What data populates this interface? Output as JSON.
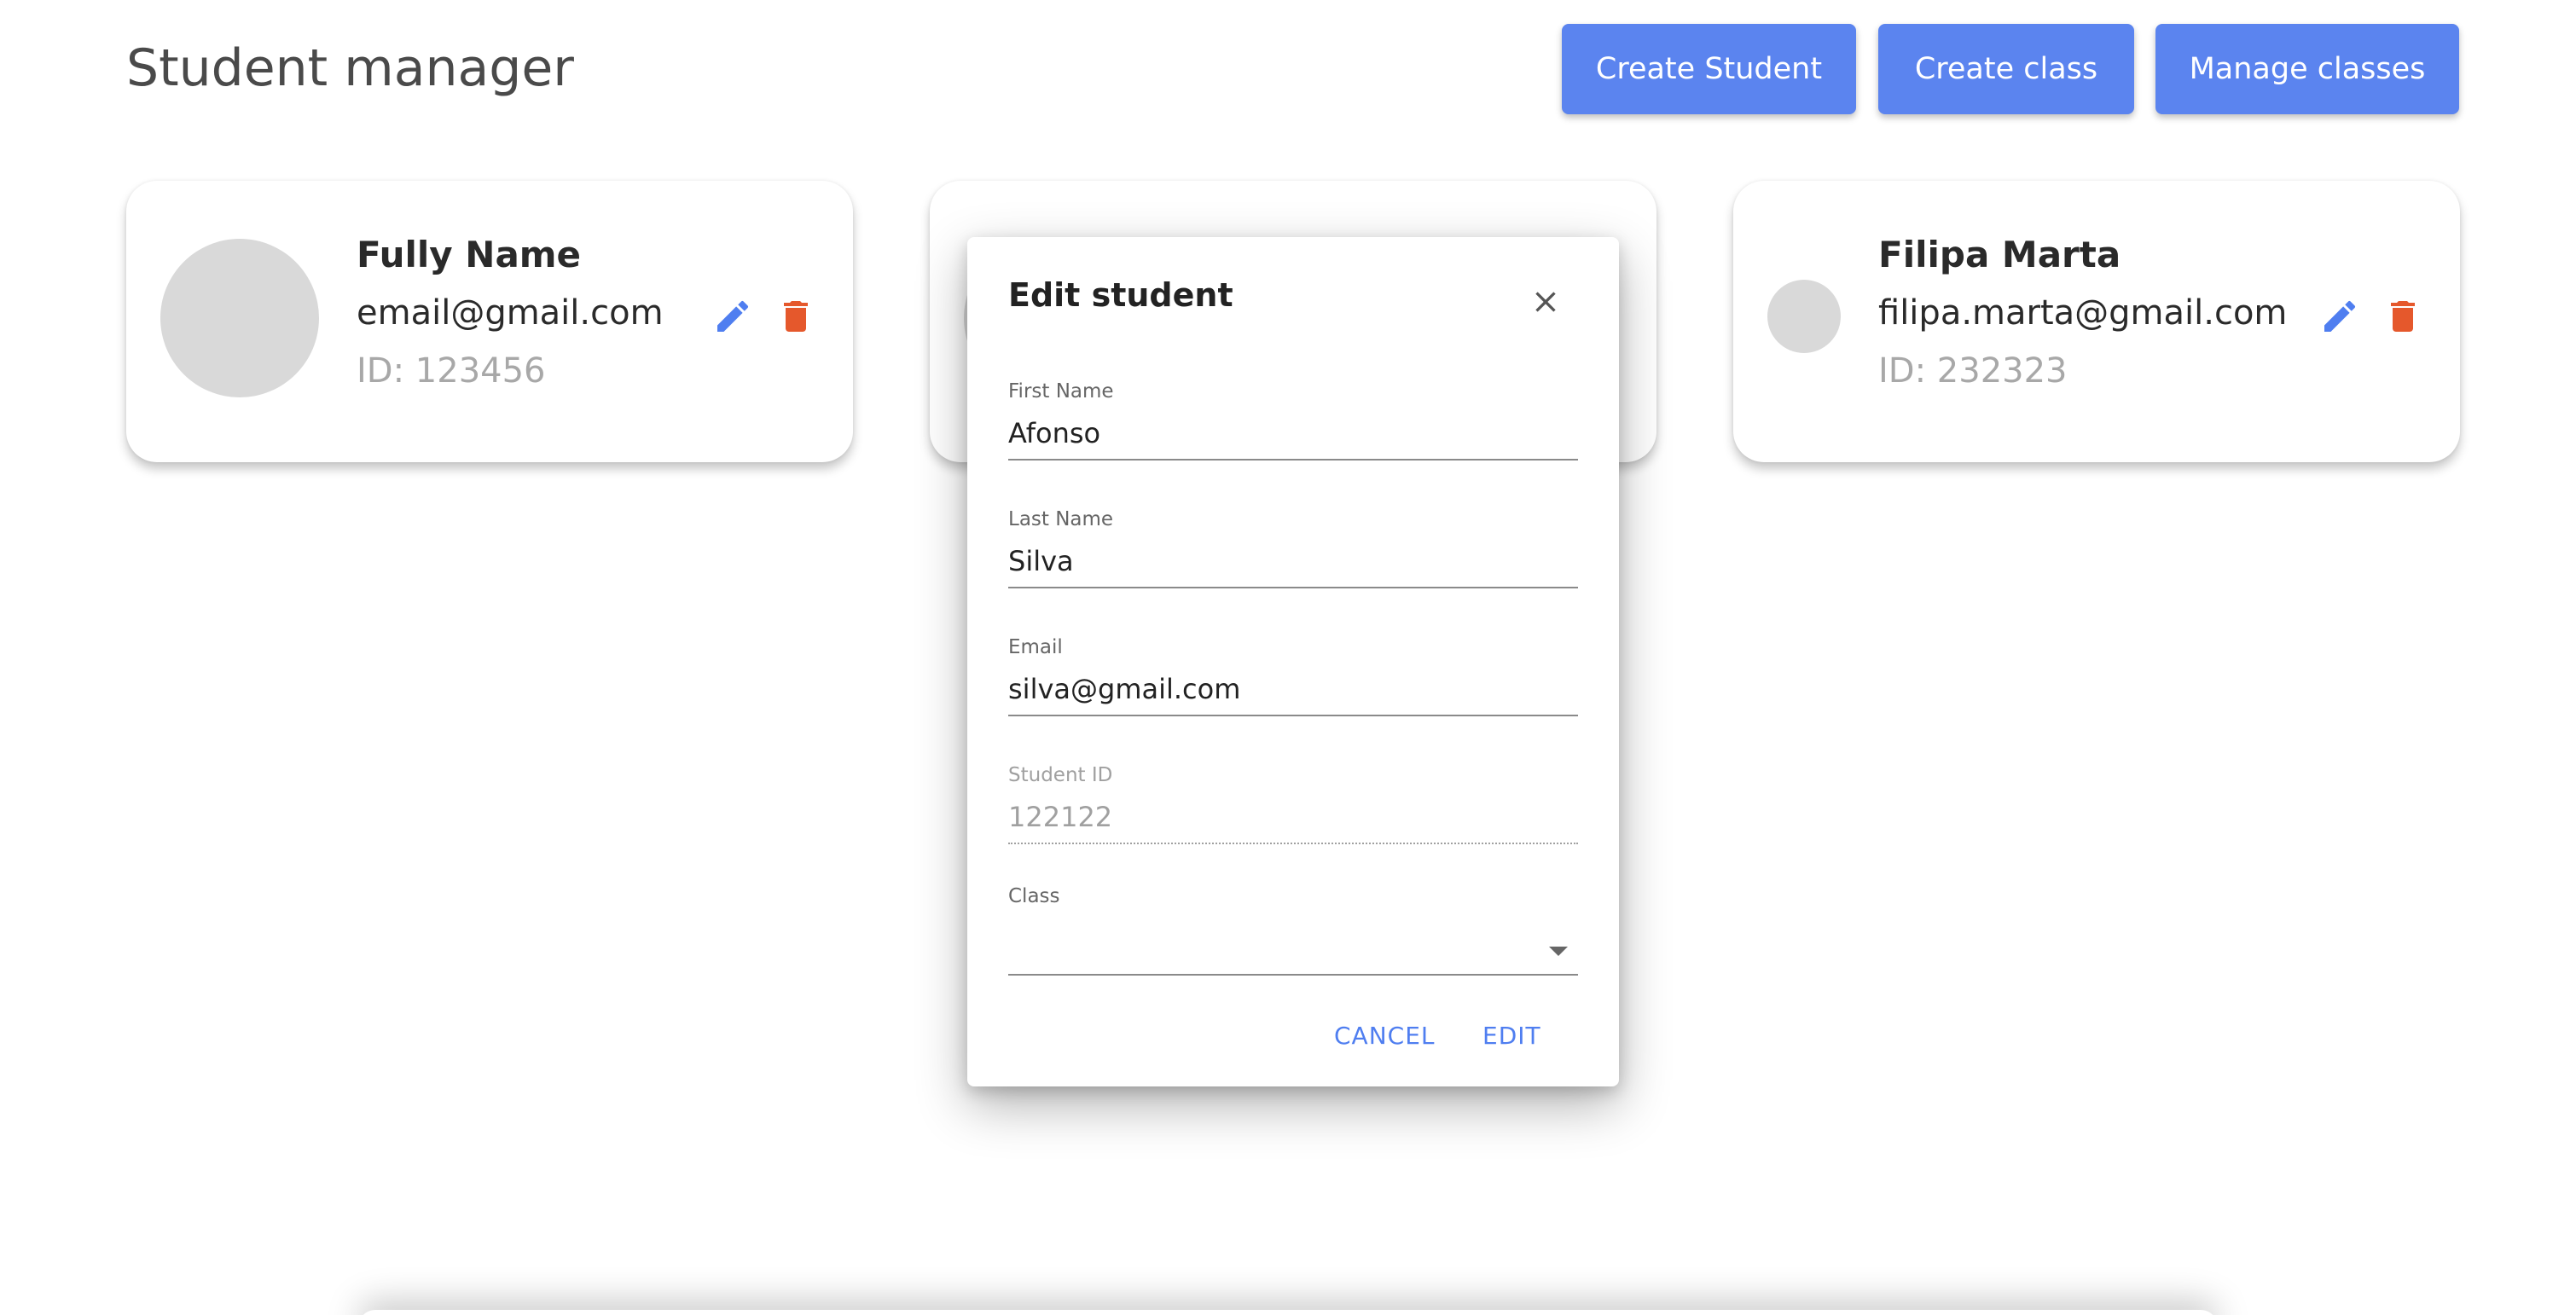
{
  "header": {
    "title": "Student manager",
    "buttons": {
      "create_student": "Create Student",
      "create_class": "Create class",
      "manage_classes": "Manage classes"
    }
  },
  "students": [
    {
      "name": "Fully Name",
      "email": "email@gmail.com",
      "id": "ID: 123456"
    },
    {
      "name": "",
      "email": "",
      "id": ""
    },
    {
      "name": "Filipa Marta",
      "email": "filipa.marta@gmail.com",
      "id": "ID: 232323"
    }
  ],
  "modal": {
    "title": "Edit student",
    "fields": {
      "first_name": {
        "label": "First Name",
        "value": "Afonso"
      },
      "last_name": {
        "label": "Last Name",
        "value": "Silva"
      },
      "email": {
        "label": "Email",
        "value": "silva@gmail.com"
      },
      "student_id": {
        "label": "Student ID",
        "value": "122122"
      },
      "class": {
        "label": "Class",
        "value": ""
      }
    },
    "actions": {
      "cancel": "CANCEL",
      "confirm": "EDIT"
    }
  },
  "icons": {
    "edit": "pencil-icon",
    "delete": "trash-icon",
    "close": "close-icon",
    "dropdown": "chevron-down-icon"
  },
  "colors": {
    "primary": "#5b84ef",
    "edit_icon": "#4f7ef0",
    "delete_icon": "#e5582c",
    "avatar": "#d9d9d9"
  }
}
